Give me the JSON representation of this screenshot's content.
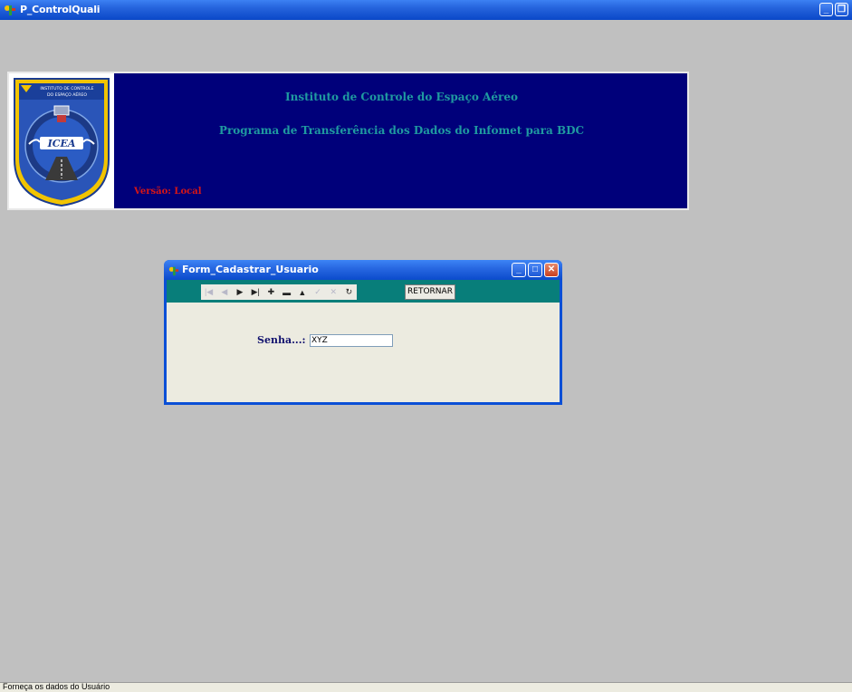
{
  "app": {
    "title": "P_ControlQuali",
    "icon": "app-icon"
  },
  "banner": {
    "line1": "Instituto de Controle do Espaço Aéreo",
    "line2": "Programa de Transferência dos Dados do Infomet para BDC",
    "version": "Versão: Local",
    "logo_text_top": "INSTITUTO DE CONTROLE",
    "logo_text_bottom": "DO ESPAÇO AÉREO",
    "logo_monogram": "ICEA"
  },
  "form": {
    "title": "Form_Cadastrar_Usuario",
    "nav_icons": [
      "first-icon",
      "prior-icon",
      "next-icon",
      "last-icon",
      "insert-icon",
      "delete-icon",
      "edit-icon",
      "post-icon",
      "cancel-icon",
      "refresh-icon"
    ],
    "return_label": "RETORNAR",
    "senha_label": "Senha...:",
    "senha_value": "XYZ"
  },
  "status": {
    "text": "Forneça os dados do Usuário"
  },
  "colors": {
    "desktop": "#c0c0c0",
    "banner_bg": "#00007a",
    "banner_text": "#1f9aa0",
    "version_text": "#d81616",
    "toolbar_bg": "#087e7a",
    "form_body": "#ecebe0"
  }
}
